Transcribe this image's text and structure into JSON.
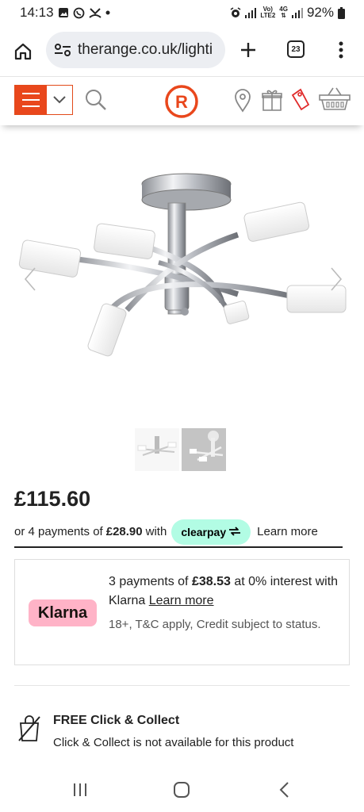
{
  "status": {
    "time": "14:13",
    "battery": "92%",
    "net_top": "Vo)",
    "net_bottom": "LTE2",
    "gen": "4G"
  },
  "browser": {
    "url": "therange.co.uk/lighti",
    "tab_count": "23"
  },
  "site": {
    "logo_letter": "R",
    "accent": "#e9471c"
  },
  "product": {
    "price": "£115.60"
  },
  "clearpay": {
    "prefix": "or 4 payments of",
    "amount": "£28.90",
    "suffix": "with",
    "badge": "clearpay",
    "learn_more": "Learn more",
    "badge_color": "#b2fce4"
  },
  "klarna": {
    "logo": "Klarna",
    "line_prefix": "3 payments of",
    "amount": "£38.53",
    "line_suffix": "at 0% interest with Klarna",
    "learn_more": "Learn more",
    "sub": "18+, T&C apply, Credit subject to status.",
    "logo_color": "#ffb3c7"
  },
  "delivery": {
    "title": "FREE Click & Collect",
    "message": "Click & Collect is not available for this product"
  },
  "icons": [
    "home-icon",
    "site-settings-icon",
    "plus-icon",
    "tab-switcher-icon",
    "more-vert-icon",
    "menu-icon",
    "chevron-down-icon",
    "search-icon",
    "store-locator-icon",
    "gift-icon",
    "tag-icon",
    "basket-icon",
    "chevron-left-icon",
    "chevron-right-icon",
    "click-collect-unavailable-icon",
    "recents-icon",
    "nav-home-icon",
    "back-icon"
  ]
}
